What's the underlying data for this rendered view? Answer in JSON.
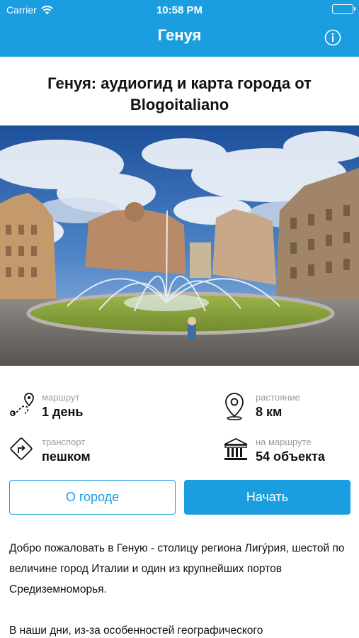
{
  "status_bar": {
    "carrier": "Carrier",
    "time": "10:58 PM"
  },
  "nav": {
    "title": "Генуя",
    "info_icon": "info-icon"
  },
  "headline": "Генуя: аудиогид и карта города от Blogoitaliano",
  "hero_image": {
    "subject": "Piazza De Ferrari fountain, Genoa"
  },
  "stats": {
    "route": {
      "caption": "маршрут",
      "value": "1 день",
      "icon": "route-icon"
    },
    "distance": {
      "caption": "растояние",
      "value": "8 км",
      "icon": "map-pin-icon"
    },
    "transport": {
      "caption": "транспорт",
      "value": "пешком",
      "icon": "directions-sign-icon"
    },
    "objects": {
      "caption": "на маршруте",
      "value": "54 объекта",
      "icon": "museum-icon"
    }
  },
  "buttons": {
    "about": "О городе",
    "start": "Начать"
  },
  "description": [
    "Добро пожаловать в Геную - столицу региона Лигу́рия, шестой по величине город Италии и один из крупнейших портов Средиземноморья.",
    "В наши дни, из-за особенностей географического"
  ],
  "colors": {
    "accent": "#1b9ee0"
  }
}
